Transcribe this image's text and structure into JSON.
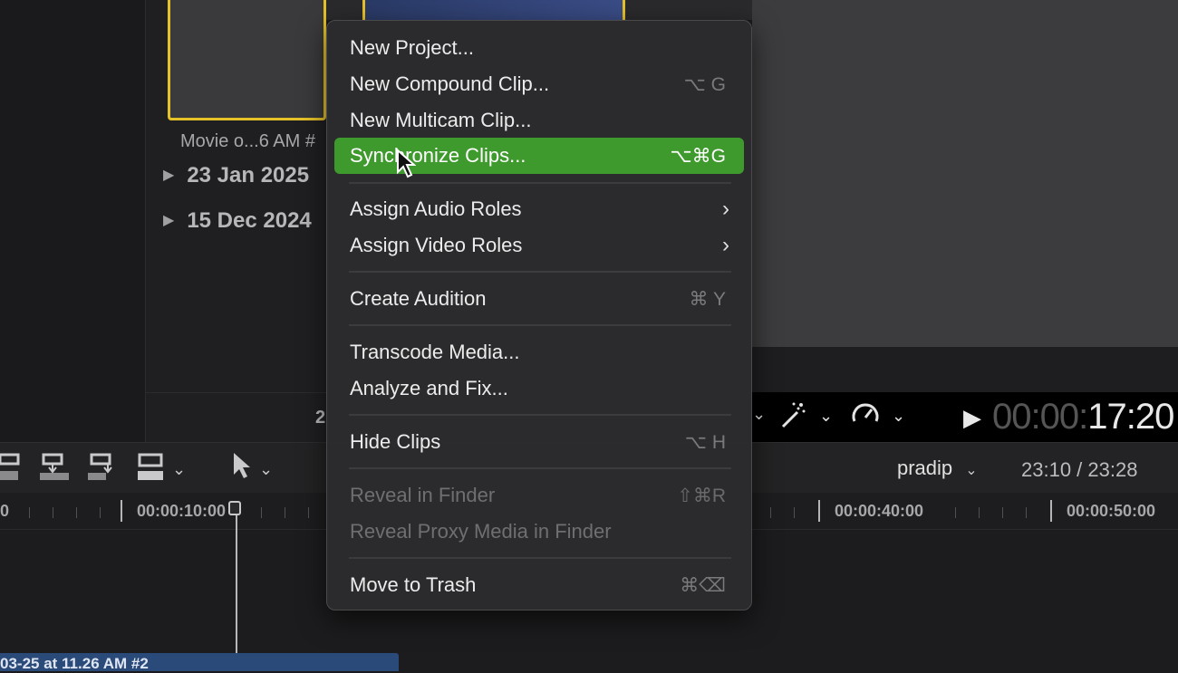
{
  "browser": {
    "clip_caption": "Movie o...6 AM #",
    "events": [
      "23 Jan 2025",
      "15 Dec 2024"
    ],
    "count_fragment": "2"
  },
  "viewer": {
    "timecode_dim": "00:00:",
    "timecode_bright": "17:20"
  },
  "toolbar": {
    "project_name": "pradip",
    "duration": "23:10 / 23:28"
  },
  "ruler": {
    "labels": [
      "0",
      "00:00:10:00",
      "00:00:40:00",
      "00:00:50:00"
    ]
  },
  "timeline": {
    "clip_label": "03-25 at 11.26 AM #2"
  },
  "menu": {
    "items": [
      {
        "label": "New Project...",
        "shortcut": ""
      },
      {
        "label": "New Compound Clip...",
        "shortcut": "⌥ G"
      },
      {
        "label": "New Multicam Clip...",
        "shortcut": ""
      },
      {
        "label": "Synchronize Clips...",
        "shortcut": "⌥⌘G"
      },
      {
        "label": "Assign Audio Roles",
        "shortcut": ""
      },
      {
        "label": "Assign Video Roles",
        "shortcut": ""
      },
      {
        "label": "Create Audition",
        "shortcut": "⌘ Y"
      },
      {
        "label": "Transcode Media...",
        "shortcut": ""
      },
      {
        "label": "Analyze and Fix...",
        "shortcut": ""
      },
      {
        "label": "Hide Clips",
        "shortcut": "⌥ H"
      },
      {
        "label": "Reveal in Finder",
        "shortcut": "⇧⌘R"
      },
      {
        "label": "Reveal Proxy Media in Finder",
        "shortcut": ""
      },
      {
        "label": "Move to Trash",
        "shortcut": "⌘⌫"
      }
    ],
    "highlight_color": "#3f9a2e"
  },
  "colors": {
    "selection_yellow": "#e6c229",
    "menu_bg": "#2c2c2e"
  }
}
